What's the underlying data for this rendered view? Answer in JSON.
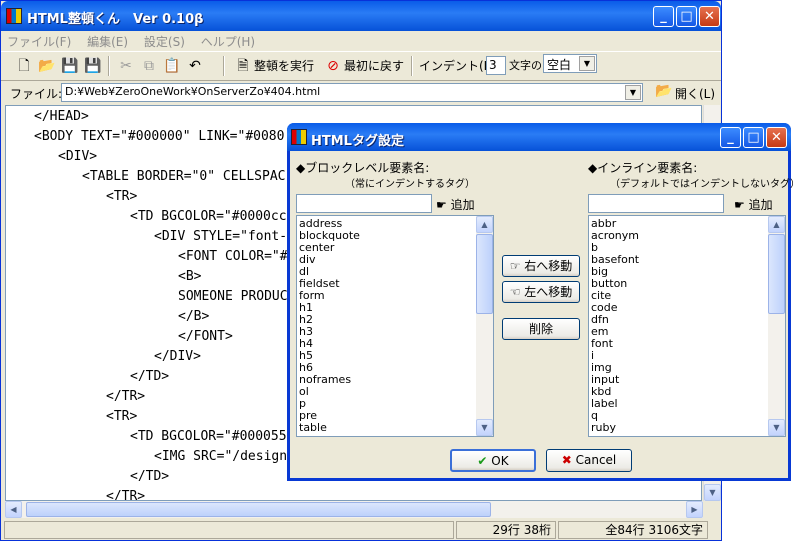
{
  "app": {
    "title": "HTML整頓くん　Ver 0.10β",
    "menu": [
      "ファイル(F)",
      "編集(E)",
      "設定(S)",
      "ヘルプ(H)"
    ],
    "toolbar": {
      "format_label": "整頓を実行",
      "revert_label": "最初に戻す",
      "indent_label": "インデント(I):",
      "indent_value": "3",
      "chars_label": "文字の",
      "char_type": "空白"
    },
    "file_label": "ファイル:",
    "file_path": "D:¥Web¥ZeroOneWork¥OnServerZo¥404.html",
    "open_label": "開く(L)",
    "editor_lines": [
      "</HEAD>",
      "<BODY TEXT=\"#000000\" LINK=\"#0080",
      "<DIV>",
      "<TABLE BORDER=\"0\" CELLSPAC",
      "<TR>",
      "<TD BGCOLOR=\"#0000cc",
      "<DIV STYLE=\"font-",
      "<FONT COLOR=\"#",
      "<B>",
      "SOMEONE PRODUC",
      "</B>",
      "</FONT>",
      "</DIV>",
      "</TD>",
      "</TR>",
      "<TR>",
      "<TD BGCOLOR=\"#000055",
      "<IMG SRC=\"/design",
      "</TD>",
      "</TR>"
    ],
    "status_position": "29行 38桁",
    "status_total": "全84行 3106文字"
  },
  "dialog": {
    "title": "HTMLタグ設定",
    "block_heading": "◆ブロックレベル要素名:",
    "block_note": "（常にインデントするタグ）",
    "inline_heading": "◆インライン要素名:",
    "inline_note": "（デフォルトではインデントしないタグ）",
    "add_label": "追加",
    "move_right_label": "右へ移動",
    "move_left_label": "左へ移動",
    "delete_label": "削除",
    "ok_label": "OK",
    "cancel_label": "Cancel",
    "block_items": [
      "address",
      "blockquote",
      "center",
      "div",
      "dl",
      "fieldset",
      "form",
      "h1",
      "h2",
      "h3",
      "h4",
      "h5",
      "h6",
      "noframes",
      "ol",
      "p",
      "pre",
      "table"
    ],
    "inline_items": [
      "abbr",
      "acronym",
      "b",
      "basefont",
      "big",
      "button",
      "cite",
      "code",
      "dfn",
      "em",
      "font",
      "i",
      "img",
      "input",
      "kbd",
      "label",
      "q",
      "ruby"
    ]
  },
  "icons": {
    "new": "new-file-icon",
    "open": "open-folder-icon",
    "save": "save-icon",
    "save_as": "save-as-icon",
    "cut": "cut-icon",
    "copy": "copy-icon",
    "paste": "paste-icon",
    "undo": "undo-icon"
  },
  "colors": {
    "titlebar": "#0a5ce8",
    "close": "#c63a14",
    "chrome": "#ece9d8",
    "border": "#7f9db9"
  }
}
